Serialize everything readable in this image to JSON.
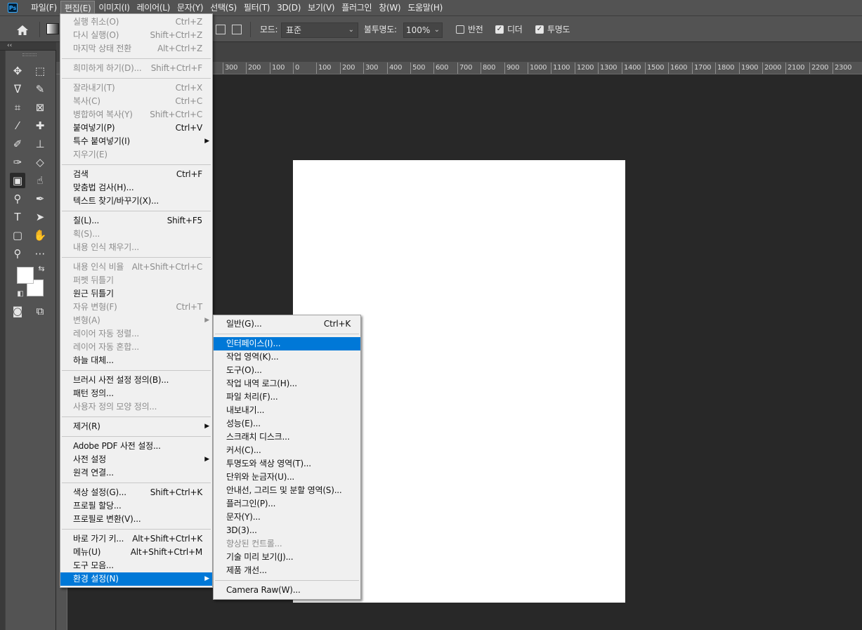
{
  "app": {
    "logo": "Ps"
  },
  "menubar": {
    "items": [
      "파일(F)",
      "편집(E)",
      "이미지(I)",
      "레이어(L)",
      "문자(Y)",
      "선택(S)",
      "필터(T)",
      "3D(D)",
      "보기(V)",
      "플러그인",
      "창(W)",
      "도움말(H)"
    ]
  },
  "options": {
    "mode_label": "모드:",
    "mode_value": "표준",
    "opacity_label": "불투명도:",
    "opacity_value": "100%",
    "reverse_label": "반전",
    "dither_label": "디더",
    "transparency_label": "투명도",
    "reverse_checked": false,
    "dither_checked": true,
    "transparency_checked": true
  },
  "toolbar": {
    "collapse": "‹‹"
  },
  "ruler": {
    "labels": [
      "300",
      "200",
      "100",
      "0",
      "100",
      "200",
      "300",
      "400",
      "500",
      "600",
      "700",
      "800",
      "900",
      "1000",
      "1100",
      "1200",
      "1300",
      "1400",
      "1500",
      "1600",
      "1700",
      "1800",
      "1900",
      "2000",
      "2100",
      "2200",
      "2300"
    ]
  },
  "edit_menu": {
    "groups": [
      [
        {
          "label": "실행 취소(O)",
          "shortcut": "Ctrl+Z",
          "disabled": true
        },
        {
          "label": "다시 실행(O)",
          "shortcut": "Shift+Ctrl+Z",
          "disabled": true
        },
        {
          "label": "마지막 상태 전환",
          "shortcut": "Alt+Ctrl+Z",
          "disabled": true
        }
      ],
      [
        {
          "label": "희미하게 하기(D)...",
          "shortcut": "Shift+Ctrl+F",
          "disabled": true
        }
      ],
      [
        {
          "label": "잘라내기(T)",
          "shortcut": "Ctrl+X",
          "disabled": true
        },
        {
          "label": "복사(C)",
          "shortcut": "Ctrl+C",
          "disabled": true
        },
        {
          "label": "병합하여 복사(Y)",
          "shortcut": "Shift+Ctrl+C",
          "disabled": true
        },
        {
          "label": "붙여넣기(P)",
          "shortcut": "Ctrl+V",
          "disabled": false
        },
        {
          "label": "특수 붙여넣기(I)",
          "shortcut": "",
          "disabled": false,
          "submenu": true
        },
        {
          "label": "지우기(E)",
          "shortcut": "",
          "disabled": true
        }
      ],
      [
        {
          "label": "검색",
          "shortcut": "Ctrl+F",
          "disabled": false
        },
        {
          "label": "맞춤법 검사(H)...",
          "shortcut": "",
          "disabled": false
        },
        {
          "label": "텍스트 찾기/바꾸기(X)...",
          "shortcut": "",
          "disabled": false
        }
      ],
      [
        {
          "label": "칠(L)...",
          "shortcut": "Shift+F5",
          "disabled": false
        },
        {
          "label": "획(S)...",
          "shortcut": "",
          "disabled": true
        },
        {
          "label": "내용 인식 채우기...",
          "shortcut": "",
          "disabled": true
        }
      ],
      [
        {
          "label": "내용 인식 비율",
          "shortcut": "Alt+Shift+Ctrl+C",
          "disabled": true
        },
        {
          "label": "퍼펫 뒤틀기",
          "shortcut": "",
          "disabled": true
        },
        {
          "label": "원근 뒤틀기",
          "shortcut": "",
          "disabled": false
        },
        {
          "label": "자유 변형(F)",
          "shortcut": "Ctrl+T",
          "disabled": true
        },
        {
          "label": "변형(A)",
          "shortcut": "",
          "disabled": true,
          "submenu": true
        },
        {
          "label": "레이어 자동 정렬...",
          "shortcut": "",
          "disabled": true
        },
        {
          "label": "레이어 자동 혼합...",
          "shortcut": "",
          "disabled": true
        },
        {
          "label": "하늘 대체...",
          "shortcut": "",
          "disabled": false
        }
      ],
      [
        {
          "label": "브러시 사전 설정 정의(B)...",
          "shortcut": "",
          "disabled": false
        },
        {
          "label": "패턴 정의...",
          "shortcut": "",
          "disabled": false
        },
        {
          "label": "사용자 정의 모양 정의...",
          "shortcut": "",
          "disabled": true
        }
      ],
      [
        {
          "label": "제거(R)",
          "shortcut": "",
          "disabled": false,
          "submenu": true
        }
      ],
      [
        {
          "label": "Adobe PDF 사전 설정...",
          "shortcut": "",
          "disabled": false
        },
        {
          "label": "사전 설정",
          "shortcut": "",
          "disabled": false,
          "submenu": true
        },
        {
          "label": "원격 연결...",
          "shortcut": "",
          "disabled": false
        }
      ],
      [
        {
          "label": "색상 설정(G)...",
          "shortcut": "Shift+Ctrl+K",
          "disabled": false
        },
        {
          "label": "프로필 할당...",
          "shortcut": "",
          "disabled": false
        },
        {
          "label": "프로필로 변환(V)...",
          "shortcut": "",
          "disabled": false
        }
      ],
      [
        {
          "label": "바로 가기 키...",
          "shortcut": "Alt+Shift+Ctrl+K",
          "disabled": false
        },
        {
          "label": "메뉴(U)",
          "shortcut": "Alt+Shift+Ctrl+M",
          "disabled": false
        },
        {
          "label": "도구 모음...",
          "shortcut": "",
          "disabled": false
        },
        {
          "label": "환경 설정(N)",
          "shortcut": "",
          "disabled": false,
          "submenu": true,
          "highlighted": true
        }
      ]
    ]
  },
  "prefs_menu": {
    "groups": [
      [
        {
          "label": "일반(G)...",
          "shortcut": "Ctrl+K",
          "disabled": false
        }
      ],
      [
        {
          "label": "인터페이스(I)...",
          "shortcut": "",
          "disabled": false,
          "highlighted": true
        },
        {
          "label": "작업 영역(K)...",
          "shortcut": "",
          "disabled": false
        },
        {
          "label": "도구(O)...",
          "shortcut": "",
          "disabled": false
        },
        {
          "label": "작업 내역 로그(H)...",
          "shortcut": "",
          "disabled": false
        },
        {
          "label": "파일 처리(F)...",
          "shortcut": "",
          "disabled": false
        },
        {
          "label": "내보내기...",
          "shortcut": "",
          "disabled": false
        },
        {
          "label": "성능(E)...",
          "shortcut": "",
          "disabled": false
        },
        {
          "label": "스크래치 디스크...",
          "shortcut": "",
          "disabled": false
        },
        {
          "label": "커서(C)...",
          "shortcut": "",
          "disabled": false
        },
        {
          "label": "투명도와 색상 영역(T)...",
          "shortcut": "",
          "disabled": false
        },
        {
          "label": "단위와 눈금자(U)...",
          "shortcut": "",
          "disabled": false
        },
        {
          "label": "안내선, 그리드 및 분할 영역(S)...",
          "shortcut": "",
          "disabled": false
        },
        {
          "label": "플러그인(P)...",
          "shortcut": "",
          "disabled": false
        },
        {
          "label": "문자(Y)...",
          "shortcut": "",
          "disabled": false
        },
        {
          "label": "3D(3)...",
          "shortcut": "",
          "disabled": false
        },
        {
          "label": "향상된 컨트롤...",
          "shortcut": "",
          "disabled": true
        },
        {
          "label": "기술 미리 보기(J)...",
          "shortcut": "",
          "disabled": false
        },
        {
          "label": "제품 개선...",
          "shortcut": "",
          "disabled": false
        }
      ],
      [
        {
          "label": "Camera Raw(W)...",
          "shortcut": "",
          "disabled": false
        }
      ]
    ]
  },
  "colors": {
    "highlight": "#0078d7",
    "menu_bg": "#f0f0f0",
    "chrome": "#535353",
    "workspace": "#282828",
    "canvas": "#ffffff"
  }
}
